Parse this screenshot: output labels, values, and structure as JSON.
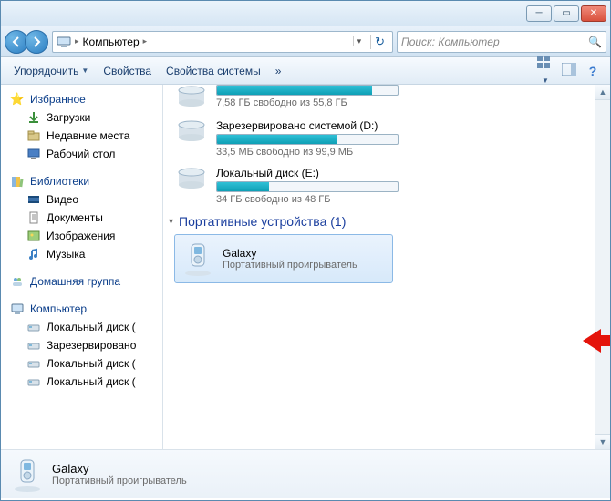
{
  "breadcrumb": {
    "root_label": "Компьютер"
  },
  "search": {
    "placeholder": "Поиск: Компьютер"
  },
  "toolbar": {
    "organize": "Упорядочить",
    "properties": "Свойства",
    "system_properties": "Свойства системы",
    "overflow": "»"
  },
  "sidebar": {
    "favorites": {
      "title": "Избранное",
      "items": [
        {
          "icon": "download-icon",
          "label": "Загрузки"
        },
        {
          "icon": "recent-icon",
          "label": "Недавние места"
        },
        {
          "icon": "desktop-icon",
          "label": "Рабочий стол"
        }
      ]
    },
    "libraries": {
      "title": "Библиотеки",
      "items": [
        {
          "icon": "video-icon",
          "label": "Видео"
        },
        {
          "icon": "documents-icon",
          "label": "Документы"
        },
        {
          "icon": "pictures-icon",
          "label": "Изображения"
        },
        {
          "icon": "music-icon",
          "label": "Музыка"
        }
      ]
    },
    "homegroup": {
      "title": "Домашняя группа"
    },
    "computer": {
      "title": "Компьютер",
      "items": [
        {
          "icon": "drive-icon",
          "label": "Локальный диск ("
        },
        {
          "icon": "drive-icon",
          "label": "Зарезервировано"
        },
        {
          "icon": "drive-icon",
          "label": "Локальный диск ("
        },
        {
          "icon": "drive-icon",
          "label": "Локальный диск ("
        }
      ]
    }
  },
  "drives": [
    {
      "name": "",
      "fill_percent": 86,
      "subtext": "7,58 ГБ свободно из 55,8 ГБ"
    },
    {
      "name": "Зарезервировано системой (D:)",
      "fill_percent": 66,
      "subtext": "33,5 МБ свободно из 99,9 МБ"
    },
    {
      "name": "Локальный диск (E:)",
      "fill_percent": 29,
      "subtext": "34 ГБ  свободно из 48 ГБ"
    }
  ],
  "portable_section": {
    "title": "Портативные устройства (1)"
  },
  "device": {
    "name": "Galaxy",
    "type": "Портативный проигрыватель"
  },
  "details": {
    "name": "Galaxy",
    "type": "Портативный проигрыватель"
  },
  "colors": {
    "accent": "#2c7ec2",
    "selection_border": "#8bb9e6",
    "progress": "#0e9fb5"
  }
}
